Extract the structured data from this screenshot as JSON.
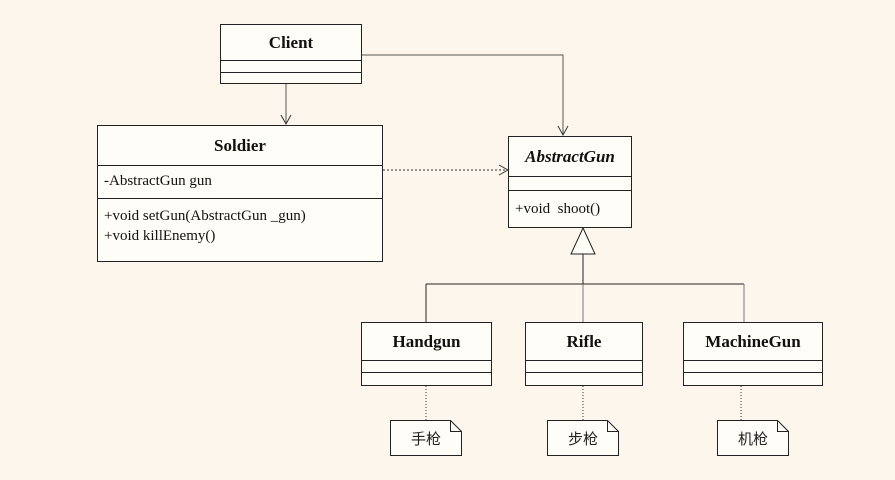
{
  "classes": {
    "client": {
      "name": "Client"
    },
    "soldier": {
      "name": "Soldier",
      "attributes": [
        "-AbstractGun gun"
      ],
      "methods": [
        "+void setGun(AbstractGun _gun)",
        "+void killEnemy()"
      ]
    },
    "abstract_gun": {
      "name": "AbstractGun",
      "methods": [
        "+void  shoot()"
      ]
    },
    "handgun": {
      "name": "Handgun"
    },
    "rifle": {
      "name": "Rifle"
    },
    "machine_gun": {
      "name": "MachineGun"
    }
  },
  "notes": {
    "handgun": "手枪",
    "rifle": "步枪",
    "machine_gun": "机枪"
  },
  "colors": {
    "background": "#fdf6ec",
    "box_fill": "#fffdf8",
    "line": "#222222",
    "arrow_line": "#555555"
  }
}
